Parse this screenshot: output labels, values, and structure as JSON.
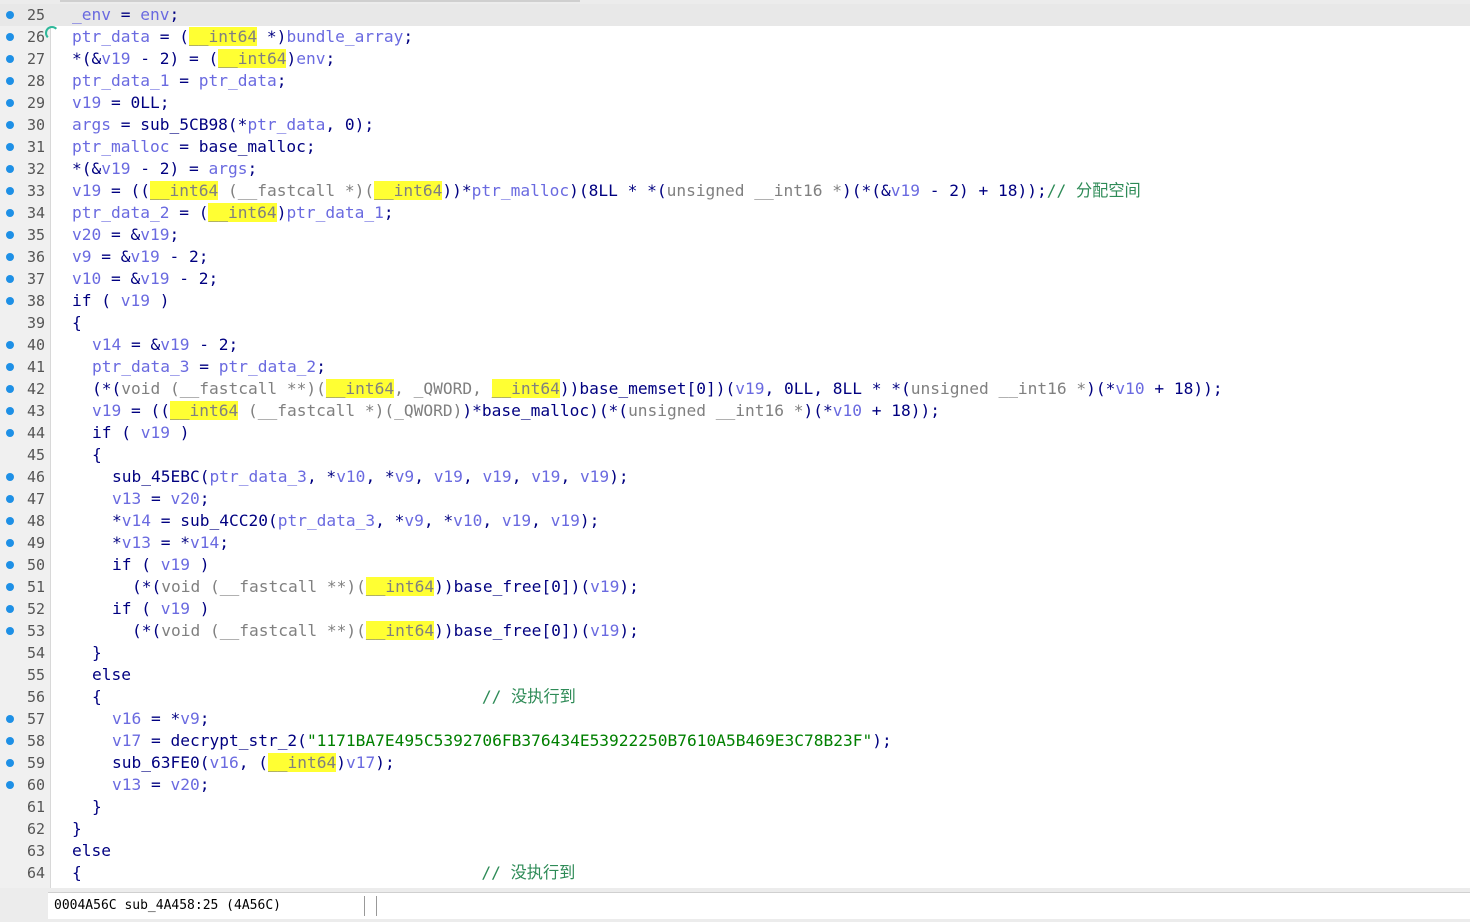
{
  "editor": {
    "lines": [
      {
        "n": "25",
        "dot": true,
        "hl": true,
        "indent": 0,
        "parts": [
          [
            "v",
            "_env"
          ],
          [
            "n",
            " = "
          ],
          [
            "v",
            "env"
          ],
          [
            "n",
            ";"
          ]
        ]
      },
      {
        "n": "26",
        "dot": true,
        "indent": 0,
        "parts": [
          [
            "v",
            "ptr_data"
          ],
          [
            "n",
            " = ("
          ],
          [
            "hy",
            "__int64"
          ],
          [
            "n",
            " *)"
          ],
          [
            "v",
            "bundle_array"
          ],
          [
            "n",
            ";"
          ]
        ]
      },
      {
        "n": "27",
        "dot": true,
        "indent": 0,
        "parts": [
          [
            "n",
            "*(&"
          ],
          [
            "v",
            "v19"
          ],
          [
            "n",
            " - 2) = ("
          ],
          [
            "hy",
            "__int64"
          ],
          [
            "n",
            ")"
          ],
          [
            "v",
            "env"
          ],
          [
            "n",
            ";"
          ]
        ]
      },
      {
        "n": "28",
        "dot": true,
        "indent": 0,
        "parts": [
          [
            "v",
            "ptr_data_1"
          ],
          [
            "n",
            " = "
          ],
          [
            "v",
            "ptr_data"
          ],
          [
            "n",
            ";"
          ]
        ]
      },
      {
        "n": "29",
        "dot": true,
        "indent": 0,
        "parts": [
          [
            "v",
            "v19"
          ],
          [
            "n",
            " = 0LL;"
          ]
        ]
      },
      {
        "n": "30",
        "dot": true,
        "indent": 0,
        "parts": [
          [
            "v",
            "args"
          ],
          [
            "n",
            " = sub_5CB98(*"
          ],
          [
            "v",
            "ptr_data"
          ],
          [
            "n",
            ", 0);"
          ]
        ]
      },
      {
        "n": "31",
        "dot": true,
        "indent": 0,
        "parts": [
          [
            "v",
            "ptr_malloc"
          ],
          [
            "n",
            " = base_malloc;"
          ]
        ]
      },
      {
        "n": "32",
        "dot": true,
        "indent": 0,
        "parts": [
          [
            "n",
            "*(&"
          ],
          [
            "v",
            "v19"
          ],
          [
            "n",
            " - 2) = "
          ],
          [
            "v",
            "args"
          ],
          [
            "n",
            ";"
          ]
        ]
      },
      {
        "n": "33",
        "dot": true,
        "indent": 0,
        "parts": [
          [
            "v",
            "v19"
          ],
          [
            "n",
            " = (("
          ],
          [
            "hy",
            "__int64"
          ],
          [
            "g",
            " (__fastcall *)("
          ],
          [
            "hy",
            "__int64"
          ],
          [
            "n",
            "))*"
          ],
          [
            "v",
            "ptr_malloc"
          ],
          [
            "n",
            ")(8LL * *("
          ],
          [
            "g",
            "unsigned __int16 *"
          ],
          [
            "n",
            ")(*(&"
          ],
          [
            "v",
            "v19"
          ],
          [
            "n",
            " - 2) + 18));"
          ],
          [
            "c",
            "// 分配空间"
          ]
        ]
      },
      {
        "n": "34",
        "dot": true,
        "indent": 0,
        "parts": [
          [
            "v",
            "ptr_data_2"
          ],
          [
            "n",
            " = ("
          ],
          [
            "hy",
            "__int64"
          ],
          [
            "n",
            ")"
          ],
          [
            "v",
            "ptr_data_1"
          ],
          [
            "n",
            ";"
          ]
        ]
      },
      {
        "n": "35",
        "dot": true,
        "indent": 0,
        "parts": [
          [
            "v",
            "v20"
          ],
          [
            "n",
            " = &"
          ],
          [
            "v",
            "v19"
          ],
          [
            "n",
            ";"
          ]
        ]
      },
      {
        "n": "36",
        "dot": true,
        "indent": 0,
        "parts": [
          [
            "v",
            "v9"
          ],
          [
            "n",
            " = &"
          ],
          [
            "v",
            "v19"
          ],
          [
            "n",
            " - 2;"
          ]
        ]
      },
      {
        "n": "37",
        "dot": true,
        "indent": 0,
        "parts": [
          [
            "v",
            "v10"
          ],
          [
            "n",
            " = &"
          ],
          [
            "v",
            "v19"
          ],
          [
            "n",
            " - 2;"
          ]
        ]
      },
      {
        "n": "38",
        "dot": true,
        "indent": 0,
        "parts": [
          [
            "n",
            "if ( "
          ],
          [
            "v",
            "v19"
          ],
          [
            "n",
            " )"
          ]
        ]
      },
      {
        "n": "39",
        "dot": false,
        "indent": 0,
        "parts": [
          [
            "n",
            "{"
          ]
        ]
      },
      {
        "n": "40",
        "dot": true,
        "indent": 1,
        "parts": [
          [
            "v",
            "v14"
          ],
          [
            "n",
            " = &"
          ],
          [
            "v",
            "v19"
          ],
          [
            "n",
            " - 2;"
          ]
        ]
      },
      {
        "n": "41",
        "dot": true,
        "indent": 1,
        "parts": [
          [
            "v",
            "ptr_data_3"
          ],
          [
            "n",
            " = "
          ],
          [
            "v",
            "ptr_data_2"
          ],
          [
            "n",
            ";"
          ]
        ]
      },
      {
        "n": "42",
        "dot": true,
        "indent": 1,
        "parts": [
          [
            "n",
            "(*("
          ],
          [
            "g",
            "void (__fastcall **)("
          ],
          [
            "hy",
            "__int64"
          ],
          [
            "g",
            ", _QWORD, "
          ],
          [
            "hy",
            "__int64"
          ],
          [
            "n",
            "))base_memset[0])("
          ],
          [
            "v",
            "v19"
          ],
          [
            "n",
            ", 0LL, 8LL * *("
          ],
          [
            "g",
            "unsigned __int16 *"
          ],
          [
            "n",
            ")(*"
          ],
          [
            "v",
            "v10"
          ],
          [
            "n",
            " + 18));"
          ]
        ]
      },
      {
        "n": "43",
        "dot": true,
        "indent": 1,
        "parts": [
          [
            "v",
            "v19"
          ],
          [
            "n",
            " = (("
          ],
          [
            "hy",
            "__int64"
          ],
          [
            "g",
            " (__fastcall *)(_QWORD)"
          ],
          [
            "n",
            ")*base_malloc)(*("
          ],
          [
            "g",
            "unsigned __int16 *"
          ],
          [
            "n",
            ")(*"
          ],
          [
            "v",
            "v10"
          ],
          [
            "n",
            " + 18));"
          ]
        ]
      },
      {
        "n": "44",
        "dot": true,
        "indent": 1,
        "parts": [
          [
            "n",
            "if ( "
          ],
          [
            "v",
            "v19"
          ],
          [
            "n",
            " )"
          ]
        ]
      },
      {
        "n": "45",
        "dot": false,
        "indent": 1,
        "parts": [
          [
            "n",
            "{"
          ]
        ]
      },
      {
        "n": "46",
        "dot": true,
        "indent": 2,
        "parts": [
          [
            "n",
            "sub_45EBC("
          ],
          [
            "v",
            "ptr_data_3"
          ],
          [
            "n",
            ", *"
          ],
          [
            "v",
            "v10"
          ],
          [
            "n",
            ", *"
          ],
          [
            "v",
            "v9"
          ],
          [
            "n",
            ", "
          ],
          [
            "v",
            "v19"
          ],
          [
            "n",
            ", "
          ],
          [
            "v",
            "v19"
          ],
          [
            "n",
            ", "
          ],
          [
            "v",
            "v19"
          ],
          [
            "n",
            ", "
          ],
          [
            "v",
            "v19"
          ],
          [
            "n",
            ");"
          ]
        ]
      },
      {
        "n": "47",
        "dot": true,
        "indent": 2,
        "parts": [
          [
            "v",
            "v13"
          ],
          [
            "n",
            " = "
          ],
          [
            "v",
            "v20"
          ],
          [
            "n",
            ";"
          ]
        ]
      },
      {
        "n": "48",
        "dot": true,
        "indent": 2,
        "parts": [
          [
            "n",
            "*"
          ],
          [
            "v",
            "v14"
          ],
          [
            "n",
            " = sub_4CC20("
          ],
          [
            "v",
            "ptr_data_3"
          ],
          [
            "n",
            ", *"
          ],
          [
            "v",
            "v9"
          ],
          [
            "n",
            ", *"
          ],
          [
            "v",
            "v10"
          ],
          [
            "n",
            ", "
          ],
          [
            "v",
            "v19"
          ],
          [
            "n",
            ", "
          ],
          [
            "v",
            "v19"
          ],
          [
            "n",
            ");"
          ]
        ]
      },
      {
        "n": "49",
        "dot": true,
        "indent": 2,
        "parts": [
          [
            "n",
            "*"
          ],
          [
            "v",
            "v13"
          ],
          [
            "n",
            " = *"
          ],
          [
            "v",
            "v14"
          ],
          [
            "n",
            ";"
          ]
        ]
      },
      {
        "n": "50",
        "dot": true,
        "indent": 2,
        "parts": [
          [
            "n",
            "if ( "
          ],
          [
            "v",
            "v19"
          ],
          [
            "n",
            " )"
          ]
        ]
      },
      {
        "n": "51",
        "dot": true,
        "indent": 3,
        "parts": [
          [
            "n",
            "(*("
          ],
          [
            "g",
            "void (__fastcall **)("
          ],
          [
            "hy",
            "__int64"
          ],
          [
            "n",
            "))base_free[0])("
          ],
          [
            "v",
            "v19"
          ],
          [
            "n",
            ");"
          ]
        ]
      },
      {
        "n": "52",
        "dot": true,
        "indent": 2,
        "parts": [
          [
            "n",
            "if ( "
          ],
          [
            "v",
            "v19"
          ],
          [
            "n",
            " )"
          ]
        ]
      },
      {
        "n": "53",
        "dot": true,
        "indent": 3,
        "parts": [
          [
            "n",
            "(*("
          ],
          [
            "g",
            "void (__fastcall **)("
          ],
          [
            "hy",
            "__int64"
          ],
          [
            "n",
            "))base_free[0])("
          ],
          [
            "v",
            "v19"
          ],
          [
            "n",
            ");"
          ]
        ]
      },
      {
        "n": "54",
        "dot": false,
        "indent": 1,
        "parts": [
          [
            "n",
            "}"
          ]
        ]
      },
      {
        "n": "55",
        "dot": false,
        "indent": 1,
        "parts": [
          [
            "n",
            "else"
          ]
        ]
      },
      {
        "n": "56",
        "dot": false,
        "indent": 1,
        "parts": [
          [
            "n",
            "{                                       "
          ],
          [
            "c",
            "// 没执行到"
          ]
        ]
      },
      {
        "n": "57",
        "dot": true,
        "indent": 2,
        "parts": [
          [
            "v",
            "v16"
          ],
          [
            "n",
            " = *"
          ],
          [
            "v",
            "v9"
          ],
          [
            "n",
            ";"
          ]
        ]
      },
      {
        "n": "58",
        "dot": true,
        "indent": 2,
        "parts": [
          [
            "v",
            "v17"
          ],
          [
            "n",
            " = decrypt_str_2("
          ],
          [
            "s",
            "\"1171BA7E495C5392706FB376434E53922250B7610A5B469E3C78B23F\""
          ],
          [
            "n",
            ");"
          ]
        ]
      },
      {
        "n": "59",
        "dot": true,
        "indent": 2,
        "parts": [
          [
            "n",
            "sub_63FE0("
          ],
          [
            "v",
            "v16"
          ],
          [
            "n",
            ", ("
          ],
          [
            "hy",
            "__int64"
          ],
          [
            "n",
            ")"
          ],
          [
            "v",
            "v17"
          ],
          [
            "n",
            ");"
          ]
        ]
      },
      {
        "n": "60",
        "dot": true,
        "indent": 2,
        "parts": [
          [
            "v",
            "v13"
          ],
          [
            "n",
            " = "
          ],
          [
            "v",
            "v20"
          ],
          [
            "n",
            ";"
          ]
        ]
      },
      {
        "n": "61",
        "dot": false,
        "indent": 1,
        "parts": [
          [
            "n",
            "}"
          ]
        ]
      },
      {
        "n": "62",
        "dot": false,
        "indent": 0,
        "parts": [
          [
            "n",
            "}"
          ]
        ]
      },
      {
        "n": "63",
        "dot": false,
        "indent": 0,
        "parts": [
          [
            "n",
            "else"
          ]
        ]
      },
      {
        "n": "64",
        "dot": false,
        "indent": 0,
        "parts": [
          [
            "n",
            "{                                         "
          ],
          [
            "c",
            "// 没执行到"
          ]
        ]
      }
    ]
  },
  "status": {
    "text": "0004A56C sub_4A458:25 (4A56C)"
  }
}
